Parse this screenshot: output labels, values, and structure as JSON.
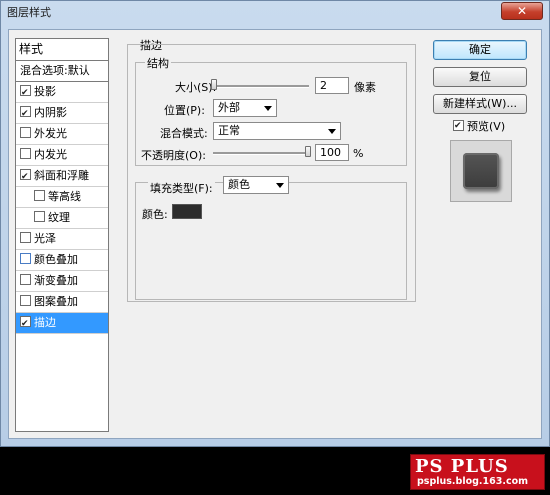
{
  "window": {
    "title": "图层样式",
    "close_glyph": "✕"
  },
  "style_list": {
    "header": "样式",
    "blend": "混合选项:默认",
    "items": [
      {
        "label": "投影",
        "checked": true
      },
      {
        "label": "内阴影",
        "checked": true
      },
      {
        "label": "外发光",
        "checked": false
      },
      {
        "label": "内发光",
        "checked": false
      },
      {
        "label": "斜面和浮雕",
        "checked": true
      },
      {
        "label": "等高线",
        "checked": false
      },
      {
        "label": "纹理",
        "checked": false
      },
      {
        "label": "光泽",
        "checked": false
      },
      {
        "label": "颜色叠加",
        "checked": false
      },
      {
        "label": "渐变叠加",
        "checked": false
      },
      {
        "label": "图案叠加",
        "checked": false
      },
      {
        "label": "描边",
        "checked": true
      }
    ]
  },
  "stroke": {
    "title": "描边",
    "structure_title": "结构",
    "size_label": "大小(S):",
    "size_value": "2",
    "size_unit": "像素",
    "position_label": "位置(P):",
    "position_value": "外部",
    "blend_mode_label": "混合模式:",
    "blend_mode_value": "正常",
    "opacity_label": "不透明度(O):",
    "opacity_value": "100",
    "opacity_unit": "%",
    "fill_type_label": "填充类型(F):",
    "fill_type_value": "颜色",
    "color_label": "颜色:",
    "color_value": "#2c2c2c",
    "size_slider_fraction": 0.0,
    "opacity_slider_fraction": 1.0
  },
  "buttons": {
    "ok": "确定",
    "reset": "复位",
    "new_style": "新建样式(W)...",
    "preview": "预览(V)",
    "preview_checked": true
  },
  "watermark": {
    "logo": "PS PLUS",
    "url": "psplus.blog.163.com"
  },
  "colors": {
    "accent": "#3399ff",
    "watermark_bg": "#c8101c"
  }
}
